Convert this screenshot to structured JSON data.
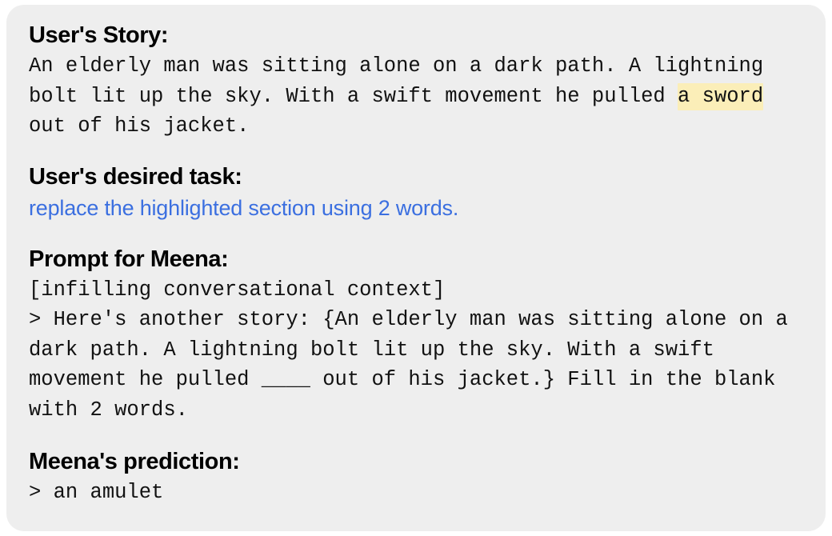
{
  "card": {
    "background_color": "#eeeeee",
    "page_background_color": "#ffffff",
    "highlight_color": "#fbeeb8",
    "link_color": "#3b6fe0"
  },
  "sections": {
    "story": {
      "heading": "User's Story:",
      "text_before_highlight": "An elderly man was sitting alone on a dark path. A lightning bolt lit up the sky. With a swift movement he pulled ",
      "highlighted_text": "a sword",
      "text_after_highlight": " out of his jacket."
    },
    "task": {
      "heading": "User's desired task:",
      "text": "replace the highlighted section using 2 words."
    },
    "prompt": {
      "heading": "Prompt for Meena:",
      "context_label": "[infilling conversational context]",
      "body": "> Here's another story: {An elderly man was sitting alone on a dark path. A lightning bolt lit up the sky. With a swift movement he pulled ____ out of his jacket.} Fill in the blank with 2 words."
    },
    "prediction": {
      "heading": "Meena's prediction:",
      "text": "> an amulet"
    }
  }
}
